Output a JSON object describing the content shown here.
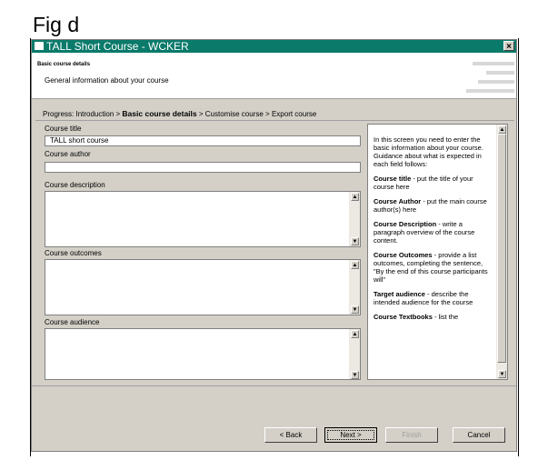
{
  "figure_label": "Fig d",
  "window": {
    "title": "TALL Short Course - WCKER",
    "close_glyph": "×"
  },
  "header": {
    "title": "Basic course details",
    "subtitle": "General information about your course"
  },
  "progress": {
    "prefix": "Progress:",
    "steps": [
      "Introduction",
      "Basic course details",
      "Customise course",
      "Export course"
    ],
    "current_index": 1,
    "separator": ">"
  },
  "form": {
    "course_title": {
      "label": "Course title",
      "value": "TALL short course"
    },
    "course_author": {
      "label": "Course author",
      "value": ""
    },
    "course_description": {
      "label": "Course description",
      "value": ""
    },
    "course_outcomes": {
      "label": "Course outcomes",
      "value": ""
    },
    "course_audience": {
      "label": "Course audience",
      "value": ""
    }
  },
  "help": {
    "intro": "In this screen you need to enter the basic information about your course. Guidance about what is expected in each field follows:",
    "items": [
      {
        "term": "Course title",
        "text": " - put the title of your course here"
      },
      {
        "term": "Course Author",
        "text": " - put the main course author(s) here"
      },
      {
        "term": "Course Description",
        "text": " - write a paragraph overview of the course content."
      },
      {
        "term": "Course Outcomes",
        "text": " - provide a list outcomes, completing the sentence, \"By the end of this course participants will\""
      },
      {
        "term": "Target audience",
        "text": " - describe the intended audience for the course"
      },
      {
        "term": "Course Textbooks",
        "text": " - list the"
      }
    ]
  },
  "buttons": {
    "back": "< Back",
    "next": "Next >",
    "finish": "Finish",
    "cancel": "Cancel"
  },
  "colors": {
    "titlebar": "#0a7a6b",
    "dialog_bg": "#d4d0c8"
  }
}
